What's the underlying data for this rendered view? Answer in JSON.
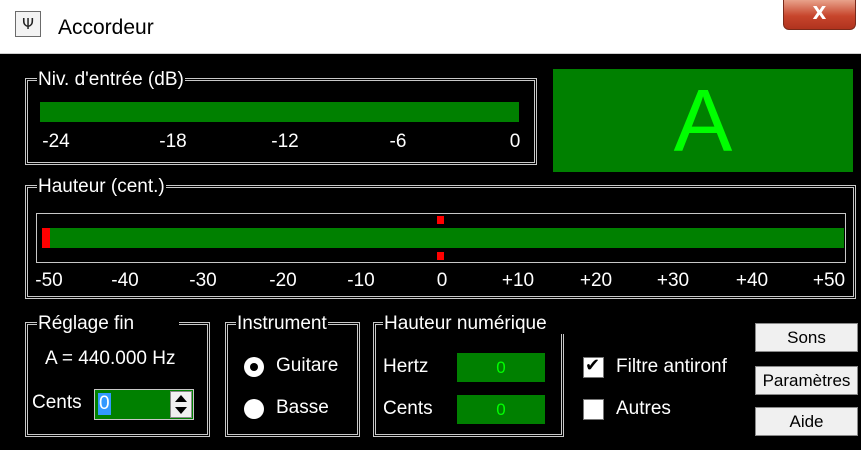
{
  "window": {
    "title": "Accordeur",
    "icon": "tuning-fork-icon",
    "close_glyph": "X"
  },
  "input_level": {
    "label": "Niv. d'entrée (dB)",
    "ticks": [
      "-24",
      "-18",
      "-12",
      "-6",
      "0"
    ]
  },
  "note": {
    "value": "A"
  },
  "pitch": {
    "label": "Hauteur (cent.)",
    "ticks": [
      "-50",
      "-40",
      "-30",
      "-20",
      "-10",
      "0",
      "+10",
      "+20",
      "+30",
      "+40",
      "+50"
    ],
    "current_cents": -50
  },
  "fine_tuning": {
    "label": "Réglage fin",
    "reference": "A = 440.000 Hz",
    "cents_label": "Cents",
    "cents_value": "0"
  },
  "instrument": {
    "label": "Instrument",
    "options": [
      {
        "label": "Guitare",
        "selected": true
      },
      {
        "label": "Basse",
        "selected": false
      }
    ]
  },
  "digital_pitch": {
    "label": "Hauteur numérique",
    "hertz_label": "Hertz",
    "hertz_value": "0",
    "cents_label": "Cents",
    "cents_value": "0"
  },
  "options": {
    "filter_label": "Filtre antironf",
    "filter_checked": true,
    "other_label": "Autres",
    "other_checked": false
  },
  "buttons": {
    "sons": "Sons",
    "parametres": "Paramètres",
    "aide": "Aide"
  },
  "colors": {
    "meter_green": "#008000",
    "note_green": "#00ff00",
    "marker_red": "#ff0000"
  }
}
